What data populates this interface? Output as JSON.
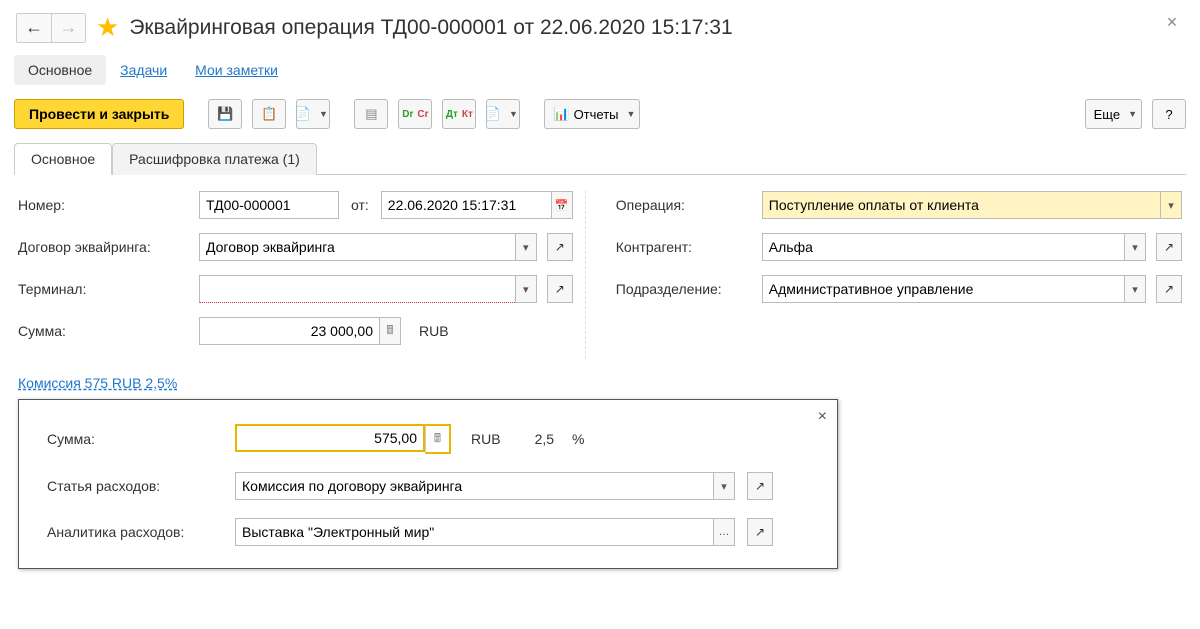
{
  "header": {
    "title": "Эквайринговая операция ТД00-000001 от 22.06.2020 15:17:31"
  },
  "navtabs": {
    "main": "Основное",
    "tasks": "Задачи",
    "notes": "Мои заметки"
  },
  "toolbar": {
    "post_and_close": "Провести и закрыть",
    "reports": "Отчеты",
    "more": "Еще",
    "help": "?"
  },
  "tabs": {
    "main": "Основное",
    "payment_detail": "Расшифровка платежа (1)"
  },
  "form": {
    "labels": {
      "number": "Номер:",
      "from": "от:",
      "date": "22.06.2020 15:17:31",
      "acquiring_contract": "Договор эквайринга:",
      "terminal": "Терминал:",
      "sum": "Сумма:",
      "operation": "Операция:",
      "counterparty": "Контрагент:",
      "department": "Подразделение:",
      "currency": "RUB"
    },
    "values": {
      "number": "ТД00-000001",
      "acquiring_contract": "Договор эквайринга",
      "terminal": "",
      "sum": "23 000,00",
      "operation": "Поступление оплаты от клиента",
      "counterparty": "Альфа",
      "department": "Административное управление"
    }
  },
  "commission": {
    "link": "Комиссия 575 RUB 2,5%",
    "labels": {
      "sum": "Сумма:",
      "expense_item": "Статья расходов:",
      "analytics": "Аналитика расходов:",
      "rub": "RUB",
      "pct_val": "2,5",
      "pct_sym": "%"
    },
    "values": {
      "sum": "575,00",
      "expense_item": "Комиссия по договору эквайринга",
      "analytics": "Выставка \"Электронный мир\""
    }
  }
}
